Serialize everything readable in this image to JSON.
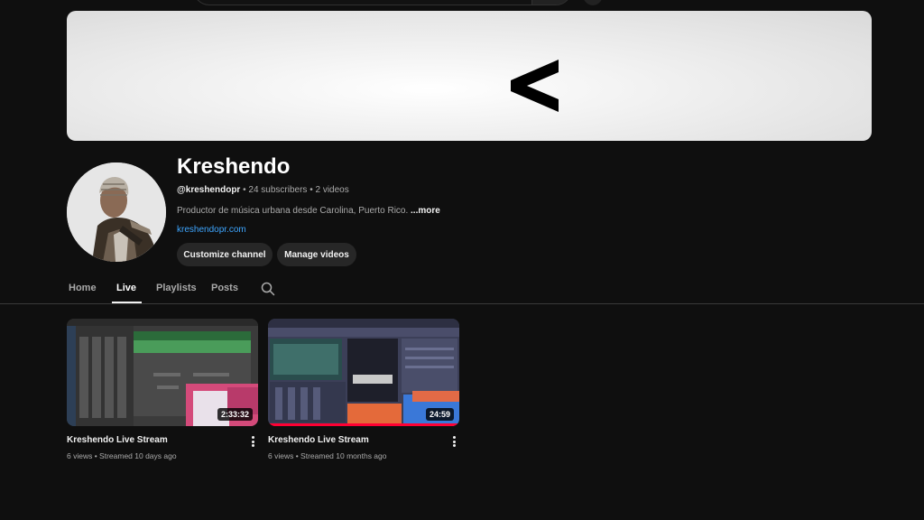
{
  "channel": {
    "name": "Kreshendo",
    "handle": "@kreshendopr",
    "stats": " • 24 subscribers • 2 videos",
    "description": "Productor de música urbana desde Carolina, Puerto Rico. ",
    "more_label": "...more",
    "link": "kreshendopr.com"
  },
  "actions": {
    "customize_label": "Customize channel",
    "manage_label": "Manage videos"
  },
  "tabs": [
    {
      "label": "Home",
      "active": false
    },
    {
      "label": "Live",
      "active": true
    },
    {
      "label": "Playlists",
      "active": false
    },
    {
      "label": "Posts",
      "active": false
    }
  ],
  "videos": [
    {
      "title": "Kreshendo Live Stream",
      "meta": "6 views • Streamed 10 days ago",
      "duration": "2:33:32",
      "watched": false
    },
    {
      "title": "Kreshendo Live Stream",
      "meta": "6 views • Streamed 10 months ago",
      "duration": "24:59",
      "watched": true
    }
  ],
  "icons": {
    "banner_logo": "chevron-left-logo",
    "tab_search": "search-icon",
    "video_menu": "more-vert-icon"
  },
  "colors": {
    "background": "#0f0f0f",
    "link": "#3ea6ff",
    "progress": "#ff0033"
  }
}
